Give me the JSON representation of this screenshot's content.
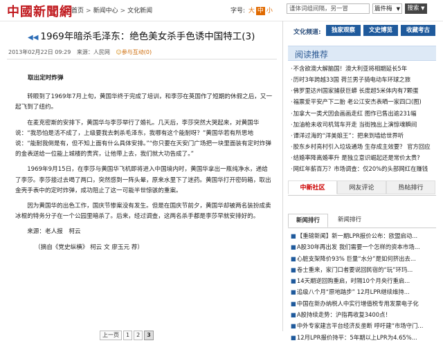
{
  "header": {
    "logo": "中國新聞網",
    "breadcrumb": [
      "首页",
      "新闻中心",
      "文化新闻"
    ],
    "font_size_label": "字号:",
    "font_sizes": [
      "大",
      "中",
      "小"
    ],
    "search_placeholder": "谨体词组间隔，另一冒",
    "search_scope": "篇件梅",
    "search_go": "搜索"
  },
  "article": {
    "title": "1969年暗杀毛泽东：绝色美女杀手色诱中国特工(3)",
    "date": "2013年02月22日 09:29",
    "source": "来源：人民网",
    "comment": "参与互动(0)",
    "subheading": "取出定时炸弹",
    "paragraphs": [
      "转眼到了1969年7月上旬，黄国华终于完成了培训，和李莎在英国作了短期的休假之后，又一起飞到了纽约。",
      "在麦克密斯的安排下，黄国华与李莎举行了婚礼。几天后，李莎突然大哭起来，对黄国华说：“我恐怕是活不成了，上级要我去刺杀毛泽东，我哪有这个能耐呀？”黄国华若有所思地说：“能耐我倒是有，但不知上面有什么具体安排。”“你只要在天安门广场把一块里面装有定时炸弹的金表送给一位能上城楼的贵宾，让他带上去，我们就大功告成了。”",
      "1969年9月15日，在李莎与黄国华飞机即将进入中国境内时，黄国华拿出一瓶纯净水，递给了李莎。李莎接过去喝了两口，突然感到一阵头晕，原来水里下了迷药。黄国华打开密码箱，取出金壳手表中的定时炸弹，成功阻止了这一可能半世惊骇的重案。",
      "因为黄国华的出色工作，国庆节惨案没有发生。但是在国庆节前夕，黄国华却被两名装扮成卖冰棍的特务分子在一个公园里暗杀了。后来，经过调查，这两名杀手都是李莎早就安排好的。"
    ],
    "source_line": "来源：老人报　柯云",
    "excerpt_line": "（摘自《党史纵横》 柯云 文 廖玉元 荐）",
    "pager": [
      "上一页",
      "1",
      "2",
      "3"
    ]
  },
  "sidebar": {
    "channel_label": "文化频道:",
    "channel_buttons": [
      "独家观察",
      "文史博览",
      "收藏考古"
    ],
    "reading_title": "阅读推荐",
    "reading_list": [
      "不含欲澳大解脑国！澳大利亚将相期延长5年",
      "历时3年跨越33国 荷兰男子骑电动车环球之旅",
      "佛罗里达州国家捕获巨蟒 长度超5米体内有7颗蛋",
      "福票爱平安产下二胎 老公江安杰表晒一家四口(图)",
      "加拿大一类犬因会画画走红 图作已售出逾231幅",
      "加油枪未收司机驾车开走 当街拽出上演惊魂瞬间",
      "谭洋过海的“洋美娘王”：把来到墙给世界听",
      "胶东乡村亮村引入垃圾通场 生存成主效要？ 官方回应",
      "结婚率降离婚率升 是独立意识崛起还是常价太贵?",
      "网红年薪百万？市场调查：仅20%的头部网红在赚钱"
    ],
    "community_tabs": [
      "中新社区",
      "网友评论",
      "热帖排行"
    ],
    "rank_tabs": [
      "新闻排行",
      "新闻排行"
    ],
    "rank_list": [
      "【重磅新闻】新一期LPR报价公布：欧盟启动...",
      "A股30年再出发 我们需要一个怎样的资本市场...",
      "心脏支架降价93% 巨量“水分”是如何挤出去...",
      "卷士重来，家门口者要说回民宿的“玩”环玛...",
      "14天期逆回购重启，时隔10个月央行重启...",
      "追级八个月“原地踏步” 12月LPR继续维持...",
      "中国在新办纳税人中实行增值税专用发票电子化",
      "A股持续走势：沪指再收复3400点！",
      "中外专家建言平台经济反垄断 呼吁建“市场守门...",
      "12月LPR报价持平：5年期以上LPR为4.65%..."
    ]
  }
}
